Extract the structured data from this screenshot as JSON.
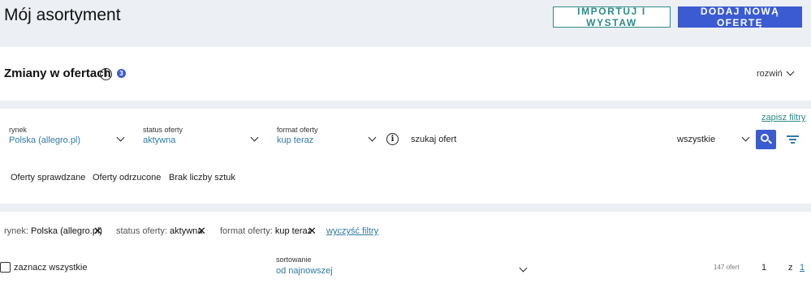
{
  "header": {
    "title": "Mój asortyment",
    "import_button": "IMPORTUJ I WYSTAW",
    "add_button": "DODAJ NOWĄ OFERTĘ"
  },
  "changes": {
    "title": "Zmiany w ofertach",
    "info_glyph": "i",
    "badge_count": "3",
    "expand_label": "rozwiń"
  },
  "filters": {
    "save_label": "zapisz filtry",
    "market": {
      "label": "rynek",
      "value": "Polska (allegro.pl)"
    },
    "status": {
      "label": "status oferty",
      "value": "aktywna"
    },
    "format": {
      "label": "format oferty",
      "value": "kup teraz"
    },
    "info_glyph": "i",
    "search_placeholder": "szukaj ofert",
    "scope_value": "wszystkie",
    "tabs": [
      "Oferty sprawdzane",
      "Oferty odrzucone",
      "Brak liczby sztuk"
    ]
  },
  "active_filters": {
    "chips": [
      {
        "label": "rynek:",
        "value": "Polska (allegro.pl)"
      },
      {
        "label": "status oferty:",
        "value": "aktywna"
      },
      {
        "label": "format oferty:",
        "value": "kup teraz"
      }
    ],
    "close_glyph": "✕",
    "clear_label": "wyczyść filtry"
  },
  "results": {
    "select_all_label": "zaznacz wszystkie",
    "sort_label": "sortowanie",
    "sort_value": "od najnowszej",
    "offer_count": "147 ofert",
    "page_current": "1",
    "page_of": "z",
    "page_total": "1"
  },
  "colors": {
    "accent_blue": "#3a5bd1",
    "teal": "#2e8a87",
    "link_blue": "#2e7ba5"
  },
  "icons": [
    "info-icon",
    "chevron-down-icon",
    "search-icon",
    "filter-lines-icon",
    "close-icon",
    "checkbox-icon"
  ]
}
